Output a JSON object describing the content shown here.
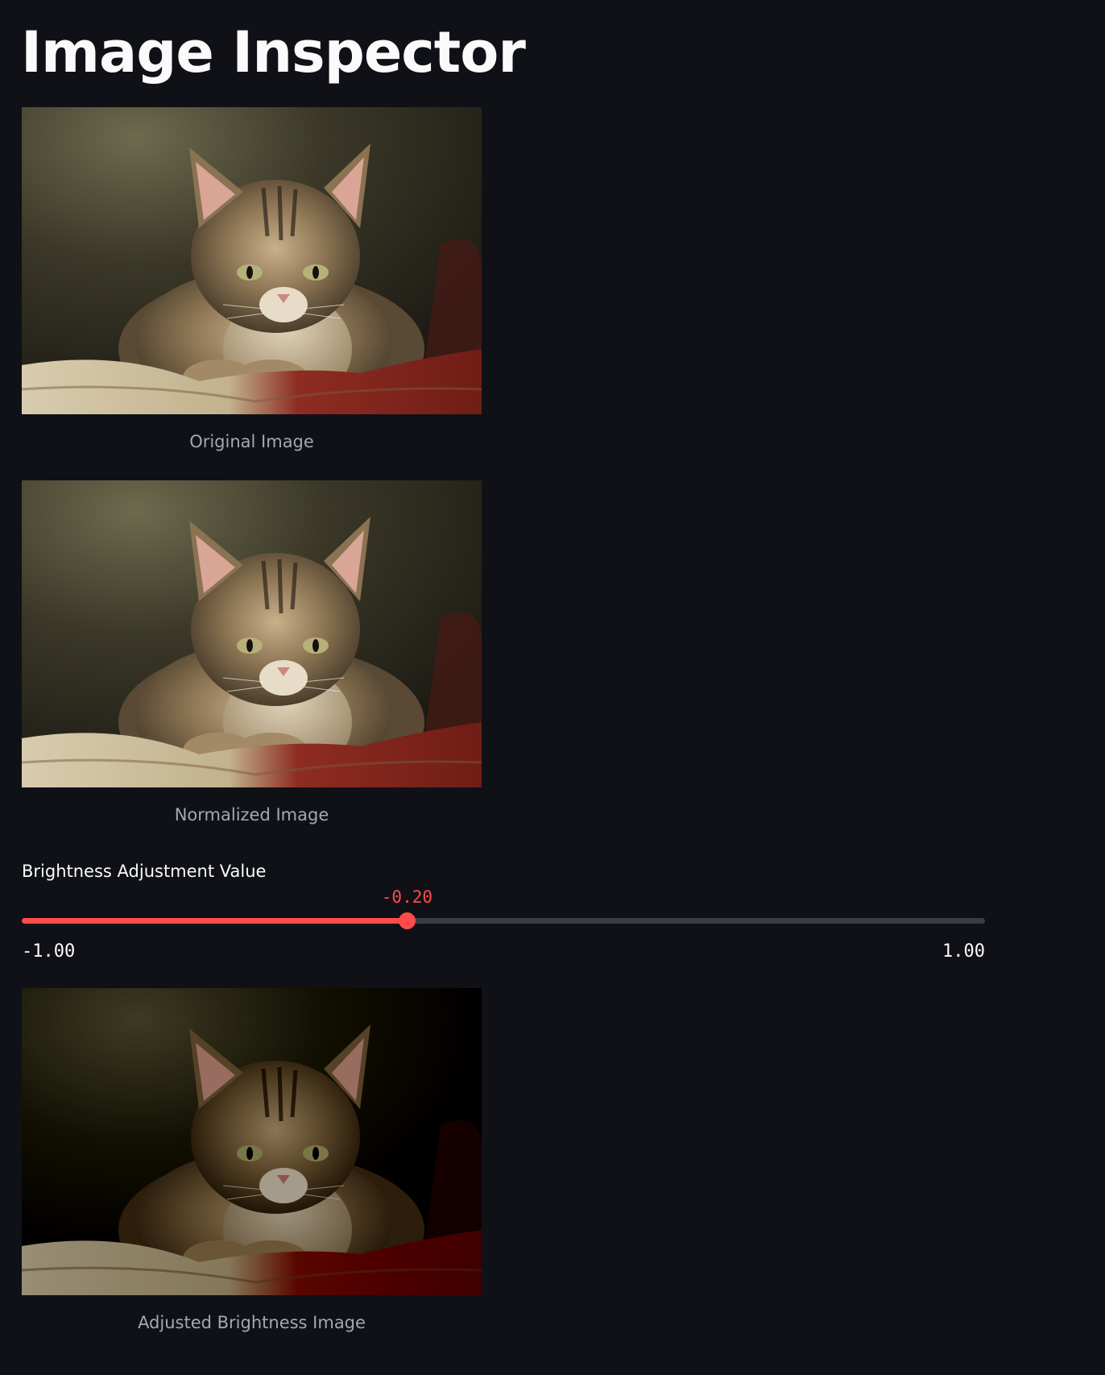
{
  "page": {
    "title": "Image Inspector"
  },
  "images": [
    {
      "caption": "Original Image",
      "brightness": 0
    },
    {
      "caption": "Normalized Image",
      "brightness": 0
    },
    {
      "caption": "Adjusted Brightness Image",
      "brightness": -0.2
    }
  ],
  "slider": {
    "label": "Brightness Adjustment Value",
    "value": -0.2,
    "value_text": "-0.20",
    "min": -1.0,
    "max": 1.0,
    "min_text": "-1.00",
    "max_text": "1.00"
  },
  "colors": {
    "background": "#0f1117",
    "accent": "#ff4b4b",
    "text": "#fafafa",
    "caption": "#a3a8b4",
    "track": "#3a3c44"
  }
}
